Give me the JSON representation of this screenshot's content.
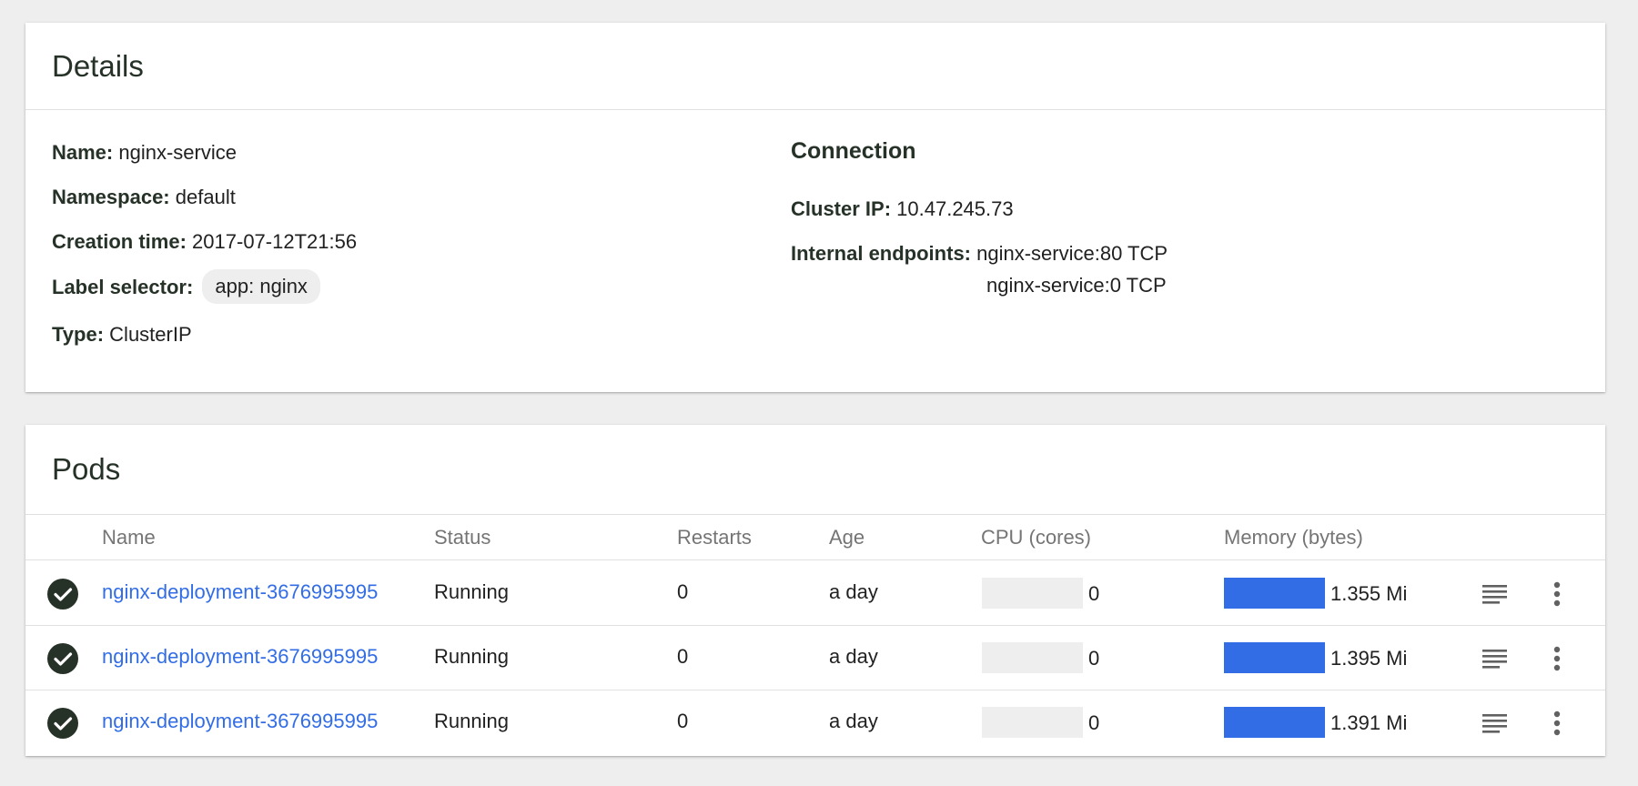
{
  "details": {
    "title": "Details",
    "fields": {
      "name": {
        "label": "Name:",
        "value": "nginx-service"
      },
      "namespace": {
        "label": "Namespace:",
        "value": "default"
      },
      "creation_time": {
        "label": "Creation time:",
        "value": "2017-07-12T21:56"
      },
      "label_selector": {
        "label": "Label selector:",
        "chip": "app: nginx"
      },
      "type": {
        "label": "Type:",
        "value": "ClusterIP"
      }
    },
    "connection": {
      "title": "Connection",
      "cluster_ip": {
        "label": "Cluster IP:",
        "value": "10.47.245.73"
      },
      "internal_endpoints": {
        "label": "Internal endpoints:",
        "values": [
          "nginx-service:80 TCP",
          "nginx-service:0 TCP"
        ]
      }
    }
  },
  "pods": {
    "title": "Pods",
    "columns": [
      "Name",
      "Status",
      "Restarts",
      "Age",
      "CPU (cores)",
      "Memory (bytes)"
    ],
    "rows": [
      {
        "name": "nginx-deployment-3676995995",
        "status": "Running",
        "restarts": "0",
        "age": "a day",
        "cpu": "0",
        "cpu_fraction": 0,
        "memory": "1.355 Mi",
        "memory_fraction": 1.0,
        "status_icon": "check-circle-icon"
      },
      {
        "name": "nginx-deployment-3676995995",
        "status": "Running",
        "restarts": "0",
        "age": "a day",
        "cpu": "0",
        "cpu_fraction": 0,
        "memory": "1.395 Mi",
        "memory_fraction": 1.0,
        "status_icon": "check-circle-icon"
      },
      {
        "name": "nginx-deployment-3676995995",
        "status": "Running",
        "restarts": "0",
        "age": "a day",
        "cpu": "0",
        "cpu_fraction": 0,
        "memory": "1.391 Mi",
        "memory_fraction": 1.0,
        "status_icon": "check-circle-icon"
      }
    ],
    "row_actions": [
      "logs-icon",
      "more-vert-icon"
    ]
  },
  "colors": {
    "accent": "#326de6",
    "status_ok": "#263228",
    "background": "#eeeeee"
  }
}
